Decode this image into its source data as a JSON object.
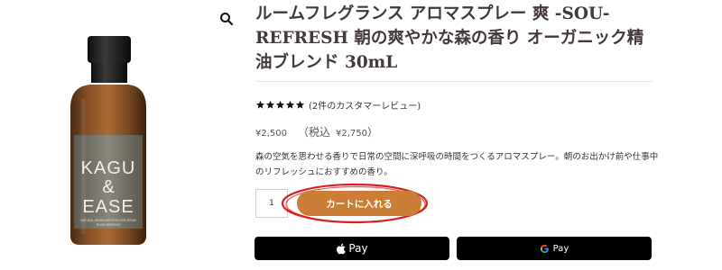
{
  "product": {
    "title": "ルームフレグランス アロマスプレー 爽 -SOU-REFRESH 朝の爽やかな森の香り オーガニック精油ブレンド 30mL",
    "bottle_label": {
      "line1": "KAGU",
      "line2": "&",
      "line3": "EASE",
      "small1": "NATURAL AROMA REFRESH FOR ROOM",
      "small2": "ROOM REFRESH"
    },
    "rating": {
      "stars": 5,
      "review_text": "(2件のカスタマーレビュー)"
    },
    "price": {
      "amount": "¥2,500",
      "tax_label": "（税込",
      "tax_amount": "¥2,750",
      "tax_close": "）"
    },
    "description": "森の空気を思わせる香りで日常の空間に深呼吸の時間をつくるアロマスプレー。朝のお出かけ前や仕事中のリフレッシュにおすすめの香り。",
    "quantity": "1",
    "cart_button": "カートに入れる",
    "apple_pay_label": "Pay",
    "google_pay_label": "Pay"
  },
  "colors": {
    "title": "#43383a",
    "cart_button": "#cc7e36",
    "highlight_ring": "#d92020",
    "pay_button": "#000000",
    "bottle_glass": "#7a4a22"
  },
  "icons": {
    "zoom": "search-icon",
    "star": "star-icon",
    "apple": "apple-icon",
    "google": "google-g-icon"
  }
}
